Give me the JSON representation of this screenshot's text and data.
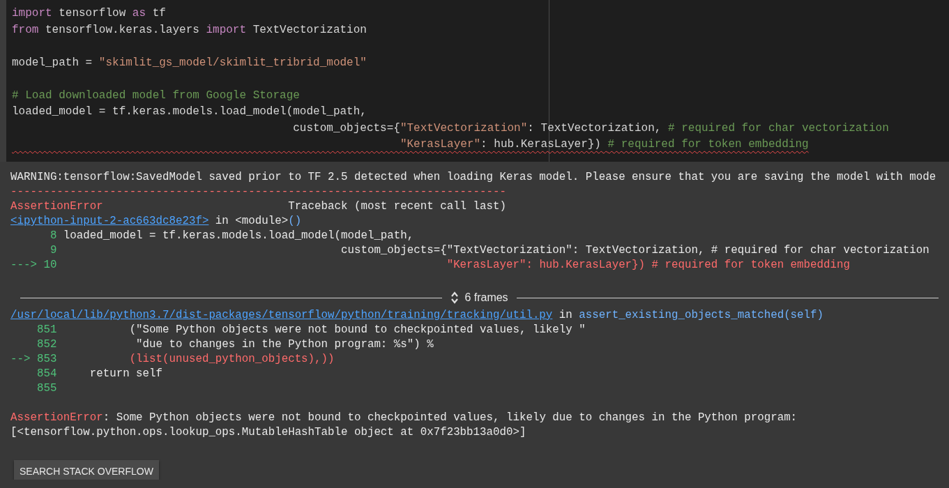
{
  "code_cell": {
    "lines": [
      {
        "segments": [
          {
            "kind": "keyword",
            "text": "import"
          },
          {
            "kind": "plain",
            "text": " tensorflow "
          },
          {
            "kind": "keyword",
            "text": "as"
          },
          {
            "kind": "plain",
            "text": " tf"
          }
        ]
      },
      {
        "segments": [
          {
            "kind": "keyword",
            "text": "from"
          },
          {
            "kind": "plain",
            "text": " tensorflow.keras.layers "
          },
          {
            "kind": "keyword",
            "text": "import"
          },
          {
            "kind": "plain",
            "text": " TextVectorization"
          }
        ]
      },
      {
        "gap_before": true,
        "segments": [
          {
            "kind": "plain",
            "text": "model_path = "
          },
          {
            "kind": "string",
            "text": "\"skimlit_gs_model/skimlit_tribrid_model\""
          }
        ]
      },
      {
        "gap_before": true,
        "segments": [
          {
            "kind": "comment",
            "text": "# Load downloaded model from Google Storage"
          }
        ]
      },
      {
        "segments": [
          {
            "kind": "plain",
            "text": "loaded_model = tf.keras.models.load_model(model_path,"
          }
        ]
      },
      {
        "segments": [
          {
            "kind": "plain",
            "text": "                                          custom_objects={"
          },
          {
            "kind": "string",
            "text": "\"TextVectorization\""
          },
          {
            "kind": "plain",
            "text": ": TextVectorization, "
          },
          {
            "kind": "comment",
            "text": "# required for char vectorization"
          }
        ]
      },
      {
        "error_underline": true,
        "segments": [
          {
            "kind": "string",
            "text": "                                                          \"KerasLayer\""
          },
          {
            "kind": "plain",
            "text": ": hub.KerasLayer}) "
          },
          {
            "kind": "comment",
            "text": "# required for token embedding"
          }
        ]
      }
    ]
  },
  "output": {
    "lines": [
      {
        "segments": [
          {
            "kind": "plain",
            "text": "WARNING:tensorflow:SavedModel saved prior to TF 2.5 detected when loading Keras model. Please ensure that you are saving the model with mode"
          }
        ]
      },
      {
        "segments": [
          {
            "kind": "error",
            "text": "---------------------------------------------------------------------------"
          }
        ]
      },
      {
        "segments": [
          {
            "kind": "error",
            "text": "AssertionError"
          },
          {
            "kind": "plain",
            "text": "                            Traceback (most recent call last)"
          }
        ]
      },
      {
        "segments": [
          {
            "kind": "link",
            "text": "<ipython-input-2-ac663dc8e23f>"
          },
          {
            "kind": "plain",
            "text": " in <module>"
          },
          {
            "kind": "func",
            "text": "()"
          }
        ]
      },
      {
        "segments": [
          {
            "kind": "lineno",
            "text": "      8"
          },
          {
            "kind": "plain",
            "text": " loaded_model = tf.keras.models.load_model(model_path,"
          }
        ]
      },
      {
        "segments": [
          {
            "kind": "lineno",
            "text": "      9"
          },
          {
            "kind": "plain",
            "text": "                                           custom_objects={\"TextVectorization\": TextVectorization, # required for char vectorization"
          }
        ]
      },
      {
        "segments": [
          {
            "kind": "lineno",
            "text": "---> 10"
          },
          {
            "kind": "error",
            "text": "                                                           \"KerasLayer\": hub.KerasLayer}) # required for token embedding"
          }
        ]
      },
      {
        "kind": "frames",
        "gap_before": true,
        "label": "6 frames"
      },
      {
        "segments": [
          {
            "kind": "link",
            "text": "/usr/local/lib/python3.7/dist-packages/tensorflow/python/training/tracking/util.py"
          },
          {
            "kind": "plain",
            "text": " in "
          },
          {
            "kind": "func",
            "text": "assert_existing_objects_matched(self)"
          }
        ]
      },
      {
        "segments": [
          {
            "kind": "lineno",
            "text": "    851"
          },
          {
            "kind": "plain",
            "text": "           (\"Some Python objects were not bound to checkpointed values, likely \""
          }
        ]
      },
      {
        "segments": [
          {
            "kind": "lineno",
            "text": "    852"
          },
          {
            "kind": "plain",
            "text": "            \"due to changes in the Python program: %s\") %"
          }
        ]
      },
      {
        "segments": [
          {
            "kind": "lineno",
            "text": "--> 853"
          },
          {
            "kind": "error",
            "text": "           (list(unused_python_objects),))"
          }
        ]
      },
      {
        "segments": [
          {
            "kind": "lineno",
            "text": "    854"
          },
          {
            "kind": "plain",
            "text": "     return self"
          }
        ]
      },
      {
        "segments": [
          {
            "kind": "lineno",
            "text": "    855"
          }
        ]
      },
      {
        "gap_before": true,
        "segments": [
          {
            "kind": "error",
            "text": "AssertionError"
          },
          {
            "kind": "plain",
            "text": ": Some Python objects were not bound to checkpointed values, likely due to changes in the Python program:"
          }
        ]
      },
      {
        "segments": [
          {
            "kind": "plain",
            "text": "[<tensorflow.python.ops.lookup_ops.MutableHashTable object at 0x7f23bb13a0d0>]"
          }
        ]
      }
    ]
  },
  "search_button": {
    "label": "SEARCH STACK OVERFLOW"
  }
}
